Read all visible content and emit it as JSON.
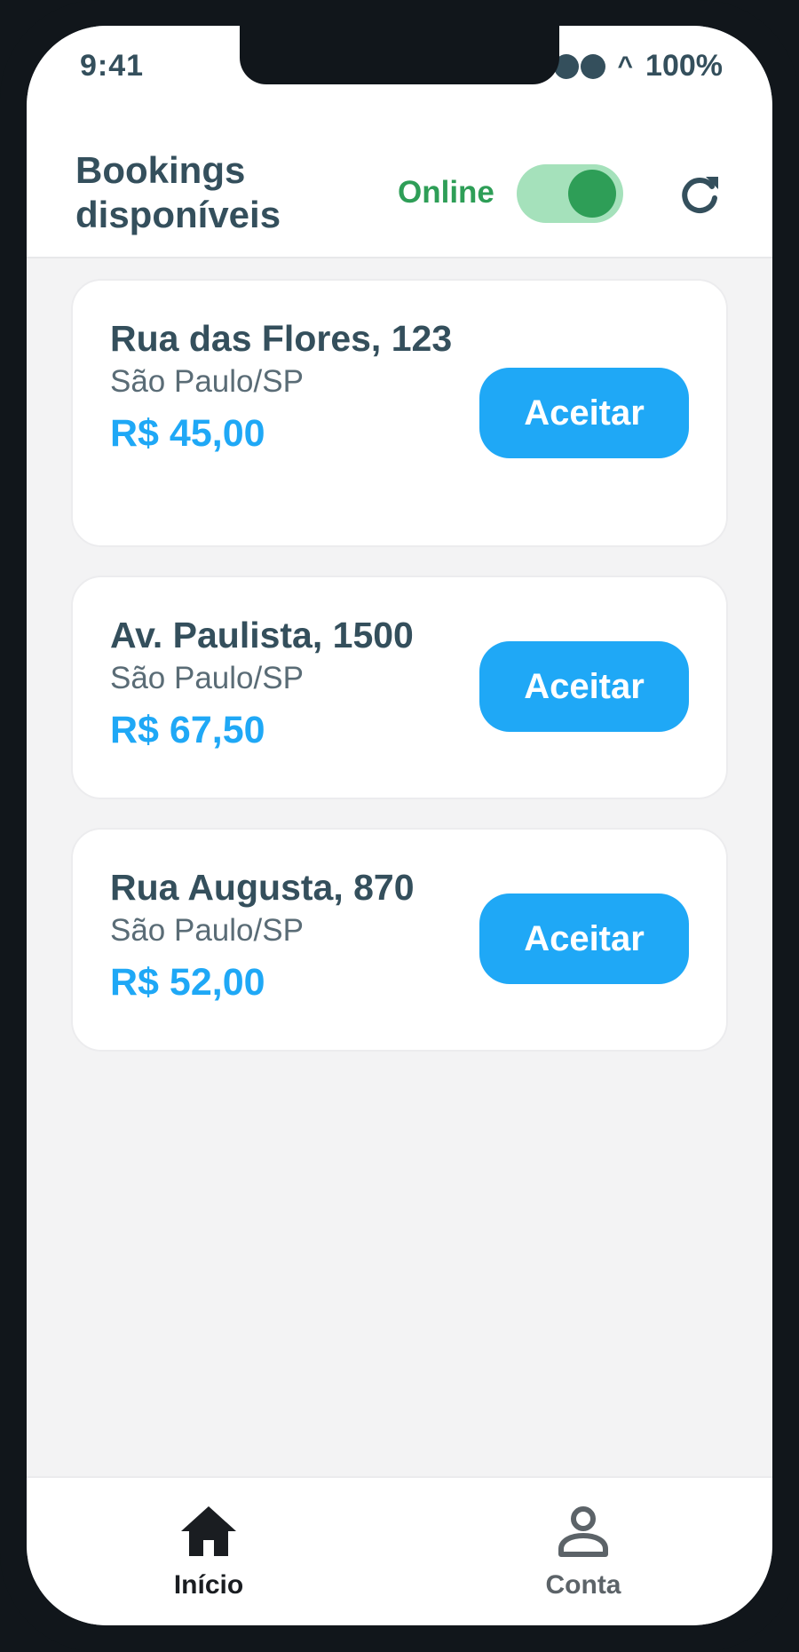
{
  "status_bar": {
    "time": "9:41",
    "battery": "100%"
  },
  "header": {
    "title": "Bookings disponíveis",
    "online_label": "Online",
    "online_toggle_on": true,
    "refresh_icon": "refresh-icon"
  },
  "bookings": [
    {
      "address": "Rua das Flores, 123",
      "city": "São Paulo/SP",
      "price": "R$ 45,00",
      "accept_label": "Aceitar"
    },
    {
      "address": "Av. Paulista, 1500",
      "city": "São Paulo/SP",
      "price": "R$ 67,50",
      "accept_label": "Aceitar"
    },
    {
      "address": "Rua Augusta, 870",
      "city": "São Paulo/SP",
      "price": "R$ 52,00",
      "accept_label": "Aceitar"
    }
  ],
  "tabbar": {
    "tabs": [
      {
        "label": "Início",
        "icon": "home-icon",
        "active": true
      },
      {
        "label": "Conta",
        "icon": "user-icon",
        "active": false
      }
    ]
  },
  "colors": {
    "primary": "#1fa8f6",
    "online_green": "#2e9e57",
    "toggle_track": "#a5e1bb",
    "text_dark": "#344f5c",
    "background": "#f3f3f4"
  }
}
